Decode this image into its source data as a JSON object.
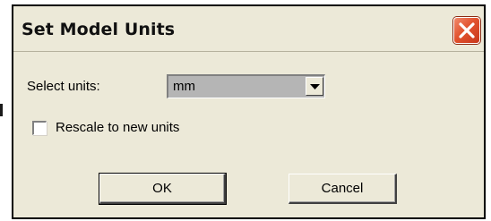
{
  "window": {
    "title": "Set Model Units",
    "close_icon": "close-icon"
  },
  "form": {
    "select_units_label": "Select units:",
    "units_value": "mm",
    "dropdown_icon": "chevron-down-icon",
    "rescale_label": "Rescale to new units",
    "rescale_checked": false
  },
  "buttons": {
    "ok_label": "OK",
    "cancel_label": "Cancel"
  },
  "colors": {
    "dialog_face": "#ece9d8",
    "close_button": "#e2532f",
    "combo_background": "#b5b5b5"
  }
}
